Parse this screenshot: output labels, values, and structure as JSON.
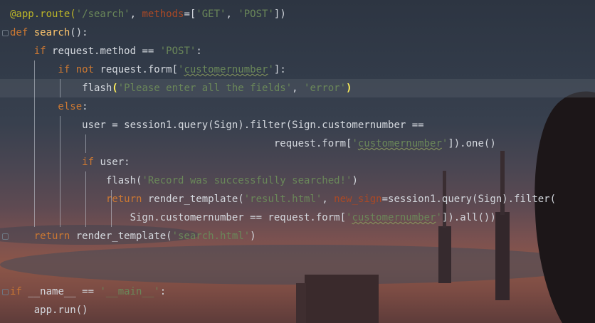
{
  "editor": {
    "lines": [
      {
        "tokens": [
          {
            "t": "@app.route(",
            "c": "dec"
          },
          {
            "t": "'/search'",
            "c": "str"
          },
          {
            "t": ", ",
            "c": "plain"
          },
          {
            "t": "methods",
            "c": "param"
          },
          {
            "t": "=[",
            "c": "plain"
          },
          {
            "t": "'GET'",
            "c": "str"
          },
          {
            "t": ", ",
            "c": "plain"
          },
          {
            "t": "'POST'",
            "c": "str"
          },
          {
            "t": "])",
            "c": "plain"
          }
        ]
      },
      {
        "tokens": [
          {
            "t": "def ",
            "c": "kw"
          },
          {
            "t": "search",
            "c": "fn"
          },
          {
            "t": "():",
            "c": "plain"
          }
        ]
      },
      {
        "tokens": [
          {
            "t": "    if ",
            "c": "kw"
          },
          {
            "t": "request.method == ",
            "c": "plain"
          },
          {
            "t": "'POST'",
            "c": "str"
          },
          {
            "t": ":",
            "c": "plain"
          }
        ]
      },
      {
        "tokens": [
          {
            "t": "        if not ",
            "c": "kw"
          },
          {
            "t": "request.form[",
            "c": "plain"
          },
          {
            "t": "'",
            "c": "str"
          },
          {
            "t": "customernumber",
            "c": "str squig"
          },
          {
            "t": "'",
            "c": "str"
          },
          {
            "t": "]:",
            "c": "plain"
          }
        ]
      },
      {
        "tokens": [
          {
            "t": "            flash",
            "c": "plain"
          },
          {
            "t": "(",
            "c": "brace-hl"
          },
          {
            "t": "'Please enter all the fields'",
            "c": "str"
          },
          {
            "t": ", ",
            "c": "plain"
          },
          {
            "t": "'error'",
            "c": "str"
          },
          {
            "t": ")",
            "c": "brace-hl"
          }
        ]
      },
      {
        "tokens": [
          {
            "t": "        else",
            "c": "kw"
          },
          {
            "t": ":",
            "c": "plain"
          }
        ]
      },
      {
        "tokens": [
          {
            "t": "            user = session1.query(Sign).filter(Sign.customernumber ==",
            "c": "plain"
          }
        ]
      },
      {
        "tokens": [
          {
            "t": "                                            request.form[",
            "c": "plain"
          },
          {
            "t": "'",
            "c": "str"
          },
          {
            "t": "customernumber",
            "c": "str squig"
          },
          {
            "t": "'",
            "c": "str"
          },
          {
            "t": "]).one()",
            "c": "plain"
          }
        ]
      },
      {
        "tokens": [
          {
            "t": "            if ",
            "c": "kw"
          },
          {
            "t": "user:",
            "c": "plain"
          }
        ]
      },
      {
        "tokens": [
          {
            "t": "                flash(",
            "c": "plain"
          },
          {
            "t": "'Record was successfully searched!'",
            "c": "str"
          },
          {
            "t": ")",
            "c": "plain"
          }
        ]
      },
      {
        "tokens": [
          {
            "t": "                return ",
            "c": "kw"
          },
          {
            "t": "render_template(",
            "c": "plain"
          },
          {
            "t": "'result.html'",
            "c": "str"
          },
          {
            "t": ", ",
            "c": "plain"
          },
          {
            "t": "new_sign",
            "c": "param"
          },
          {
            "t": "=session1.query(Sign).filter(",
            "c": "plain"
          }
        ]
      },
      {
        "tokens": [
          {
            "t": "                    Sign.customernumber == request.form[",
            "c": "plain"
          },
          {
            "t": "'",
            "c": "str"
          },
          {
            "t": "customernumber",
            "c": "str squig"
          },
          {
            "t": "'",
            "c": "str"
          },
          {
            "t": "]).all())",
            "c": "plain"
          }
        ]
      },
      {
        "tokens": [
          {
            "t": "    return ",
            "c": "kw"
          },
          {
            "t": "render_template(",
            "c": "plain"
          },
          {
            "t": "'search.html'",
            "c": "str"
          },
          {
            "t": ")",
            "c": "plain"
          }
        ]
      },
      {
        "tokens": []
      },
      {
        "tokens": []
      },
      {
        "tokens": [
          {
            "t": "if ",
            "c": "kw"
          },
          {
            "t": "__name__ == ",
            "c": "plain"
          },
          {
            "t": "'__main__'",
            "c": "str"
          },
          {
            "t": ":",
            "c": "plain"
          }
        ]
      },
      {
        "tokens": [
          {
            "t": "    app.run()",
            "c": "plain"
          }
        ]
      }
    ]
  }
}
